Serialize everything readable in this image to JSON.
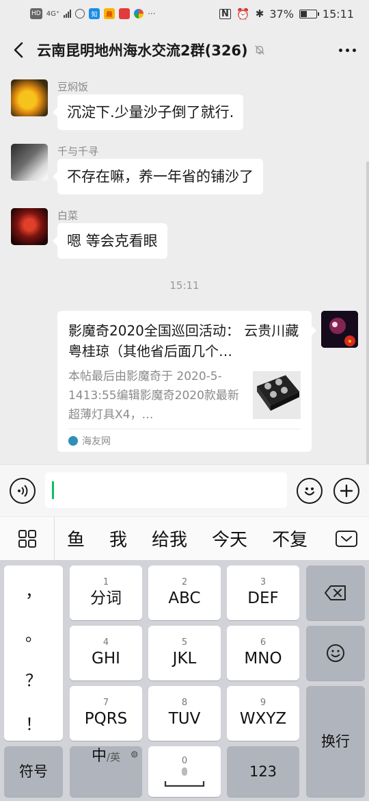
{
  "status_bar": {
    "left_badges": [
      "HD",
      "4G⁺",
      "知",
      "趣",
      "",
      ""
    ],
    "battery_level": 0.37,
    "battery": "37%",
    "time": "15:11"
  },
  "header": {
    "title": "云南昆明地州海水交流2群(326)"
  },
  "messages": [
    {
      "sender": "豆焖饭",
      "text": "沉淀下.少量沙子倒了就行."
    },
    {
      "sender": "千与千寻",
      "text": "不存在嘛，养一年省的铺沙了"
    },
    {
      "sender": "白菜",
      "text": "嗯 等会克看眼"
    }
  ],
  "timestamp": "15:11",
  "link_card": {
    "title": "影魔奇2020全国巡回活动： 云贵川藏粤桂琼（其他省后面几个…",
    "description": "本帖最后由影魔奇于 2020-5-1413:55编辑影魔奇2020款最新超薄灯具X4，…",
    "source": "海友网"
  },
  "input": {
    "value": ""
  },
  "candidates": [
    "鱼",
    "我",
    "给我",
    "今天",
    "不复"
  ],
  "keyboard": {
    "punct": [
      "，",
      "。",
      "？",
      "！"
    ],
    "keys": [
      {
        "num": "1",
        "label": "分词"
      },
      {
        "num": "2",
        "label": "ABC"
      },
      {
        "num": "3",
        "label": "DEF"
      },
      {
        "num": "4",
        "label": "GHI"
      },
      {
        "num": "5",
        "label": "JKL"
      },
      {
        "num": "6",
        "label": "MNO"
      },
      {
        "num": "7",
        "label": "PQRS"
      },
      {
        "num": "8",
        "label": "TUV"
      },
      {
        "num": "9",
        "label": "WXYZ"
      }
    ],
    "symbols": "符号",
    "chinese": "中",
    "english": "/英",
    "space_num": "0",
    "numbers": "123",
    "enter": "换行"
  },
  "icons": {
    "back": "chevron-left-icon",
    "mute": "bell-muted-icon",
    "more": "more-dots-icon",
    "voice": "voice-icon",
    "emoji": "emoji-icon",
    "plus": "plus-icon",
    "backspace": "backspace-icon",
    "mic": "mic-icon",
    "globe": "globe-icon"
  },
  "colors": {
    "background": "#ededed",
    "bubble": "#ffffff",
    "caret": "#07c160",
    "keyboard_bg": "#d1d3d8",
    "dark_key": "#b0b4bc"
  }
}
